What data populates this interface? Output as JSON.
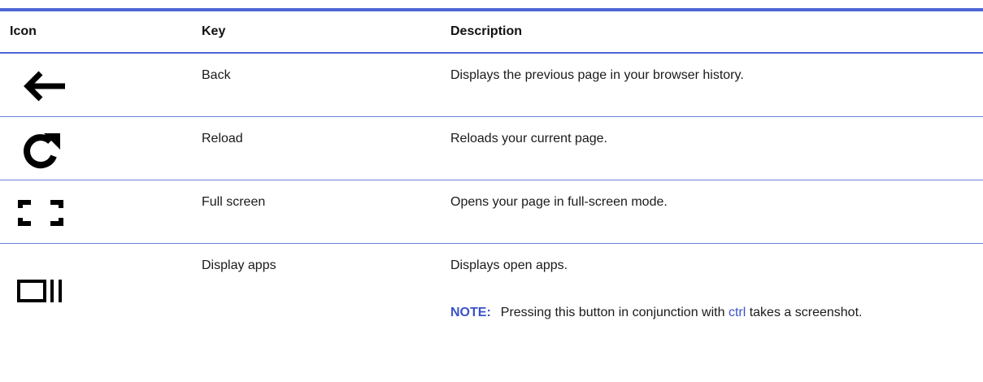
{
  "table": {
    "headers": {
      "icon": "Icon",
      "key": "Key",
      "description": "Description"
    },
    "rows": [
      {
        "icon": "back-arrow-icon",
        "key": "Back",
        "description": "Displays the previous page in your browser history."
      },
      {
        "icon": "reload-icon",
        "key": "Reload",
        "description": "Reloads your current page."
      },
      {
        "icon": "fullscreen-icon",
        "key": "Full screen",
        "description": "Opens your page in full-screen mode."
      },
      {
        "icon": "display-apps-icon",
        "key": "Display apps",
        "description": "Displays open apps.",
        "note": {
          "label": "NOTE:",
          "text_before": "Pressing this button in conjunction with ",
          "link": "ctrl",
          "text_after": " takes a screenshot."
        }
      }
    ]
  },
  "colors": {
    "accent": "#4e66d6",
    "note_text": "#3a52c9"
  }
}
